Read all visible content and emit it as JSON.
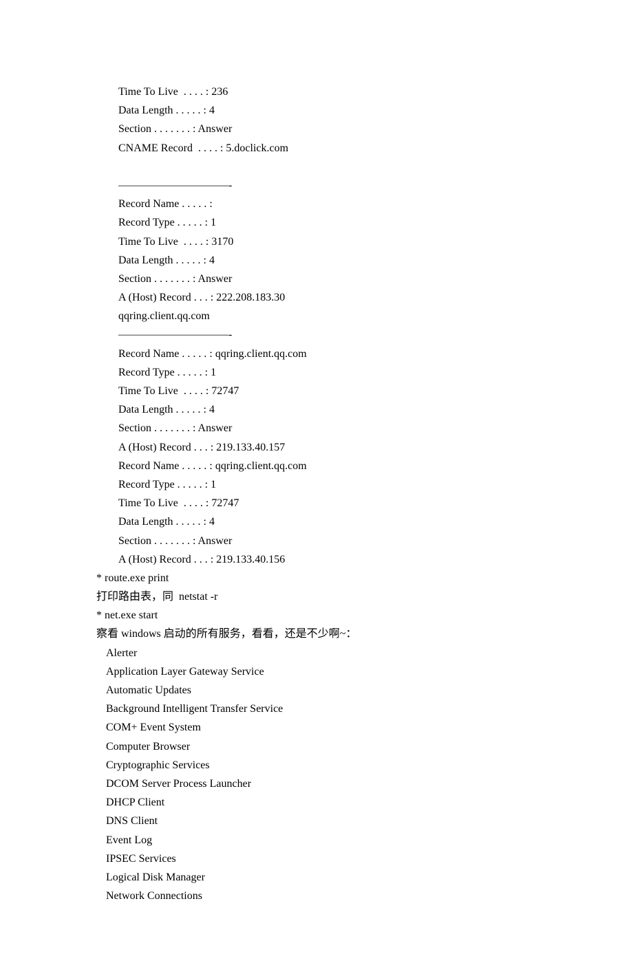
{
  "lines": [
    {
      "cls": "indent",
      "text": "Time To Live  . . . . : 236"
    },
    {
      "cls": "indent",
      "text": "Data Length . . . . . : 4"
    },
    {
      "cls": "indent",
      "text": "Section . . . . . . . : Answer"
    },
    {
      "cls": "indent",
      "text": "CNAME Record  . . . . : 5.doclick.com"
    },
    {
      "cls": "indent",
      "text": " "
    },
    {
      "cls": "indent",
      "text": "——————————-"
    },
    {
      "cls": "indent",
      "text": "Record Name . . . . . :"
    },
    {
      "cls": "indent",
      "text": "Record Type . . . . . : 1"
    },
    {
      "cls": "indent",
      "text": "Time To Live  . . . . : 3170"
    },
    {
      "cls": "indent",
      "text": "Data Length . . . . . : 4"
    },
    {
      "cls": "indent",
      "text": "Section . . . . . . . : Answer"
    },
    {
      "cls": "indent",
      "text": "A (Host) Record . . . : 222.208.183.30"
    },
    {
      "cls": "indent",
      "text": "qqring.client.qq.com"
    },
    {
      "cls": "indent",
      "text": "——————————-"
    },
    {
      "cls": "indent",
      "text": "Record Name . . . . . : qqring.client.qq.com"
    },
    {
      "cls": "indent",
      "text": "Record Type . . . . . : 1"
    },
    {
      "cls": "indent",
      "text": "Time To Live  . . . . : 72747"
    },
    {
      "cls": "indent",
      "text": "Data Length . . . . . : 4"
    },
    {
      "cls": "indent",
      "text": "Section . . . . . . . : Answer"
    },
    {
      "cls": "indent",
      "text": "A (Host) Record . . . : 219.133.40.157"
    },
    {
      "cls": "indent",
      "text": "Record Name . . . . . : qqring.client.qq.com"
    },
    {
      "cls": "indent",
      "text": "Record Type . . . . . : 1"
    },
    {
      "cls": "indent",
      "text": "Time To Live  . . . . : 72747"
    },
    {
      "cls": "indent",
      "text": "Data Length . . . . . : 4"
    },
    {
      "cls": "indent",
      "text": "Section . . . . . . . : Answer"
    },
    {
      "cls": "indent",
      "text": "A (Host) Record . . . : 219.133.40.156"
    },
    {
      "cls": "",
      "text": "* route.exe print"
    },
    {
      "cls": "",
      "text": "打印路由表，同  netstat -r"
    },
    {
      "cls": "",
      "text": "* net.exe start"
    },
    {
      "cls": "",
      "text": "察看 windows 启动的所有服务，看看，还是不少啊~："
    },
    {
      "cls": "indent2",
      "text": "Alerter"
    },
    {
      "cls": "indent2",
      "text": "Application Layer Gateway Service"
    },
    {
      "cls": "indent2",
      "text": "Automatic Updates"
    },
    {
      "cls": "indent2",
      "text": "Background Intelligent Transfer Service"
    },
    {
      "cls": "indent2",
      "text": "COM+ Event System"
    },
    {
      "cls": "indent2",
      "text": "Computer Browser"
    },
    {
      "cls": "indent2",
      "text": "Cryptographic Services"
    },
    {
      "cls": "indent2",
      "text": "DCOM Server Process Launcher"
    },
    {
      "cls": "indent2",
      "text": "DHCP Client"
    },
    {
      "cls": "indent2",
      "text": "DNS Client"
    },
    {
      "cls": "indent2",
      "text": "Event Log"
    },
    {
      "cls": "indent2",
      "text": "IPSEC Services"
    },
    {
      "cls": "indent2",
      "text": "Logical Disk Manager"
    },
    {
      "cls": "indent2",
      "text": "Network Connections"
    }
  ]
}
